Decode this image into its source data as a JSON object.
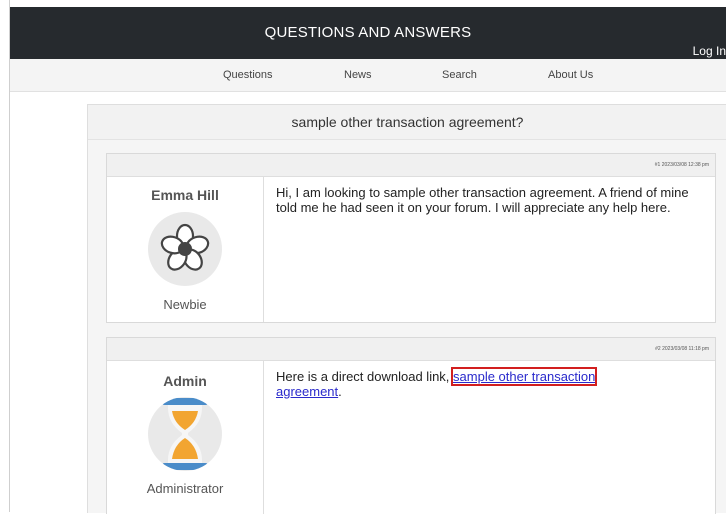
{
  "header": {
    "title": "QUESTIONS AND ANSWERS",
    "login": "Log In"
  },
  "nav": [
    {
      "label": "Questions"
    },
    {
      "label": "News"
    },
    {
      "label": "Search"
    },
    {
      "label": "About Us"
    }
  ],
  "thread": {
    "title": "sample other transaction agreement?",
    "posts": [
      {
        "meta": "#1 2023/03/08 12:38 pm",
        "author": "Emma Hill",
        "rank": "Newbie",
        "avatar_icon": "flower-icon",
        "message": "Hi, I am looking to sample other transaction agreement. A friend of mine told me he had seen it on your forum. I will appreciate any help here."
      },
      {
        "meta": "#2 2023/03/08 11:18 pm",
        "author": "Admin",
        "rank": "Administrator",
        "avatar_icon": "hourglass-icon",
        "message_prefix": "Here is a direct download link, ",
        "link_text_line1": "sample other transaction",
        "link_text_line2": "agreement",
        "message_suffix": "."
      }
    ]
  },
  "colors": {
    "header_bg": "#262a2e",
    "link": "#2a2acc",
    "highlight_box": "#d21f1f",
    "hourglass_cap": "#4a8cc9",
    "hourglass_sand": "#f2a531"
  }
}
